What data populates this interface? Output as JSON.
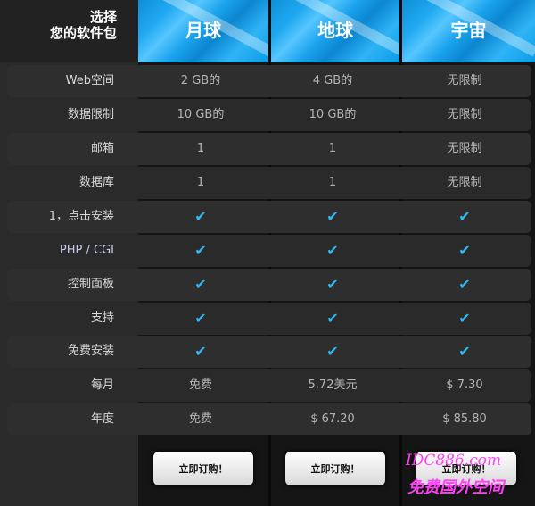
{
  "header": {
    "corner_line1": "选择",
    "corner_line2": "您的软件包",
    "plans": [
      "月球",
      "地球",
      "宇宙"
    ]
  },
  "rows": [
    {
      "label": "Web空间",
      "values": [
        "2 GB的",
        "4 GB的",
        "无限制"
      ]
    },
    {
      "label": "数据限制",
      "values": [
        "10 GB的",
        "10 GB的",
        "无限制"
      ]
    },
    {
      "label": "邮箱",
      "values": [
        "1",
        "1",
        "无限制"
      ]
    },
    {
      "label": "数据库",
      "values": [
        "1",
        "1",
        "无限制"
      ]
    },
    {
      "label": "1，点击安装",
      "values": [
        "✔",
        "✔",
        "✔"
      ]
    },
    {
      "label": "PHP / CGI",
      "values": [
        "✔",
        "✔",
        "✔"
      ]
    },
    {
      "label": "控制面板",
      "values": [
        "✔",
        "✔",
        "✔"
      ]
    },
    {
      "label": "支持",
      "values": [
        "✔",
        "✔",
        "✔"
      ]
    },
    {
      "label": "免费安装",
      "values": [
        "✔",
        "✔",
        "✔"
      ]
    },
    {
      "label": "每月",
      "values": [
        "免费",
        "5.72美元",
        "$ 7.30"
      ]
    },
    {
      "label": "年度",
      "values": [
        "免费",
        "$ 67.20",
        "$ 85.80"
      ]
    }
  ],
  "buttons": {
    "order_label": "立即订购！"
  },
  "watermark": {
    "line1": "IDC886.com",
    "line2": "免费国外空间"
  },
  "colors": {
    "accent": "#1fa8f0",
    "check": "#35b8ef",
    "watermark": "#ff3ff6"
  }
}
